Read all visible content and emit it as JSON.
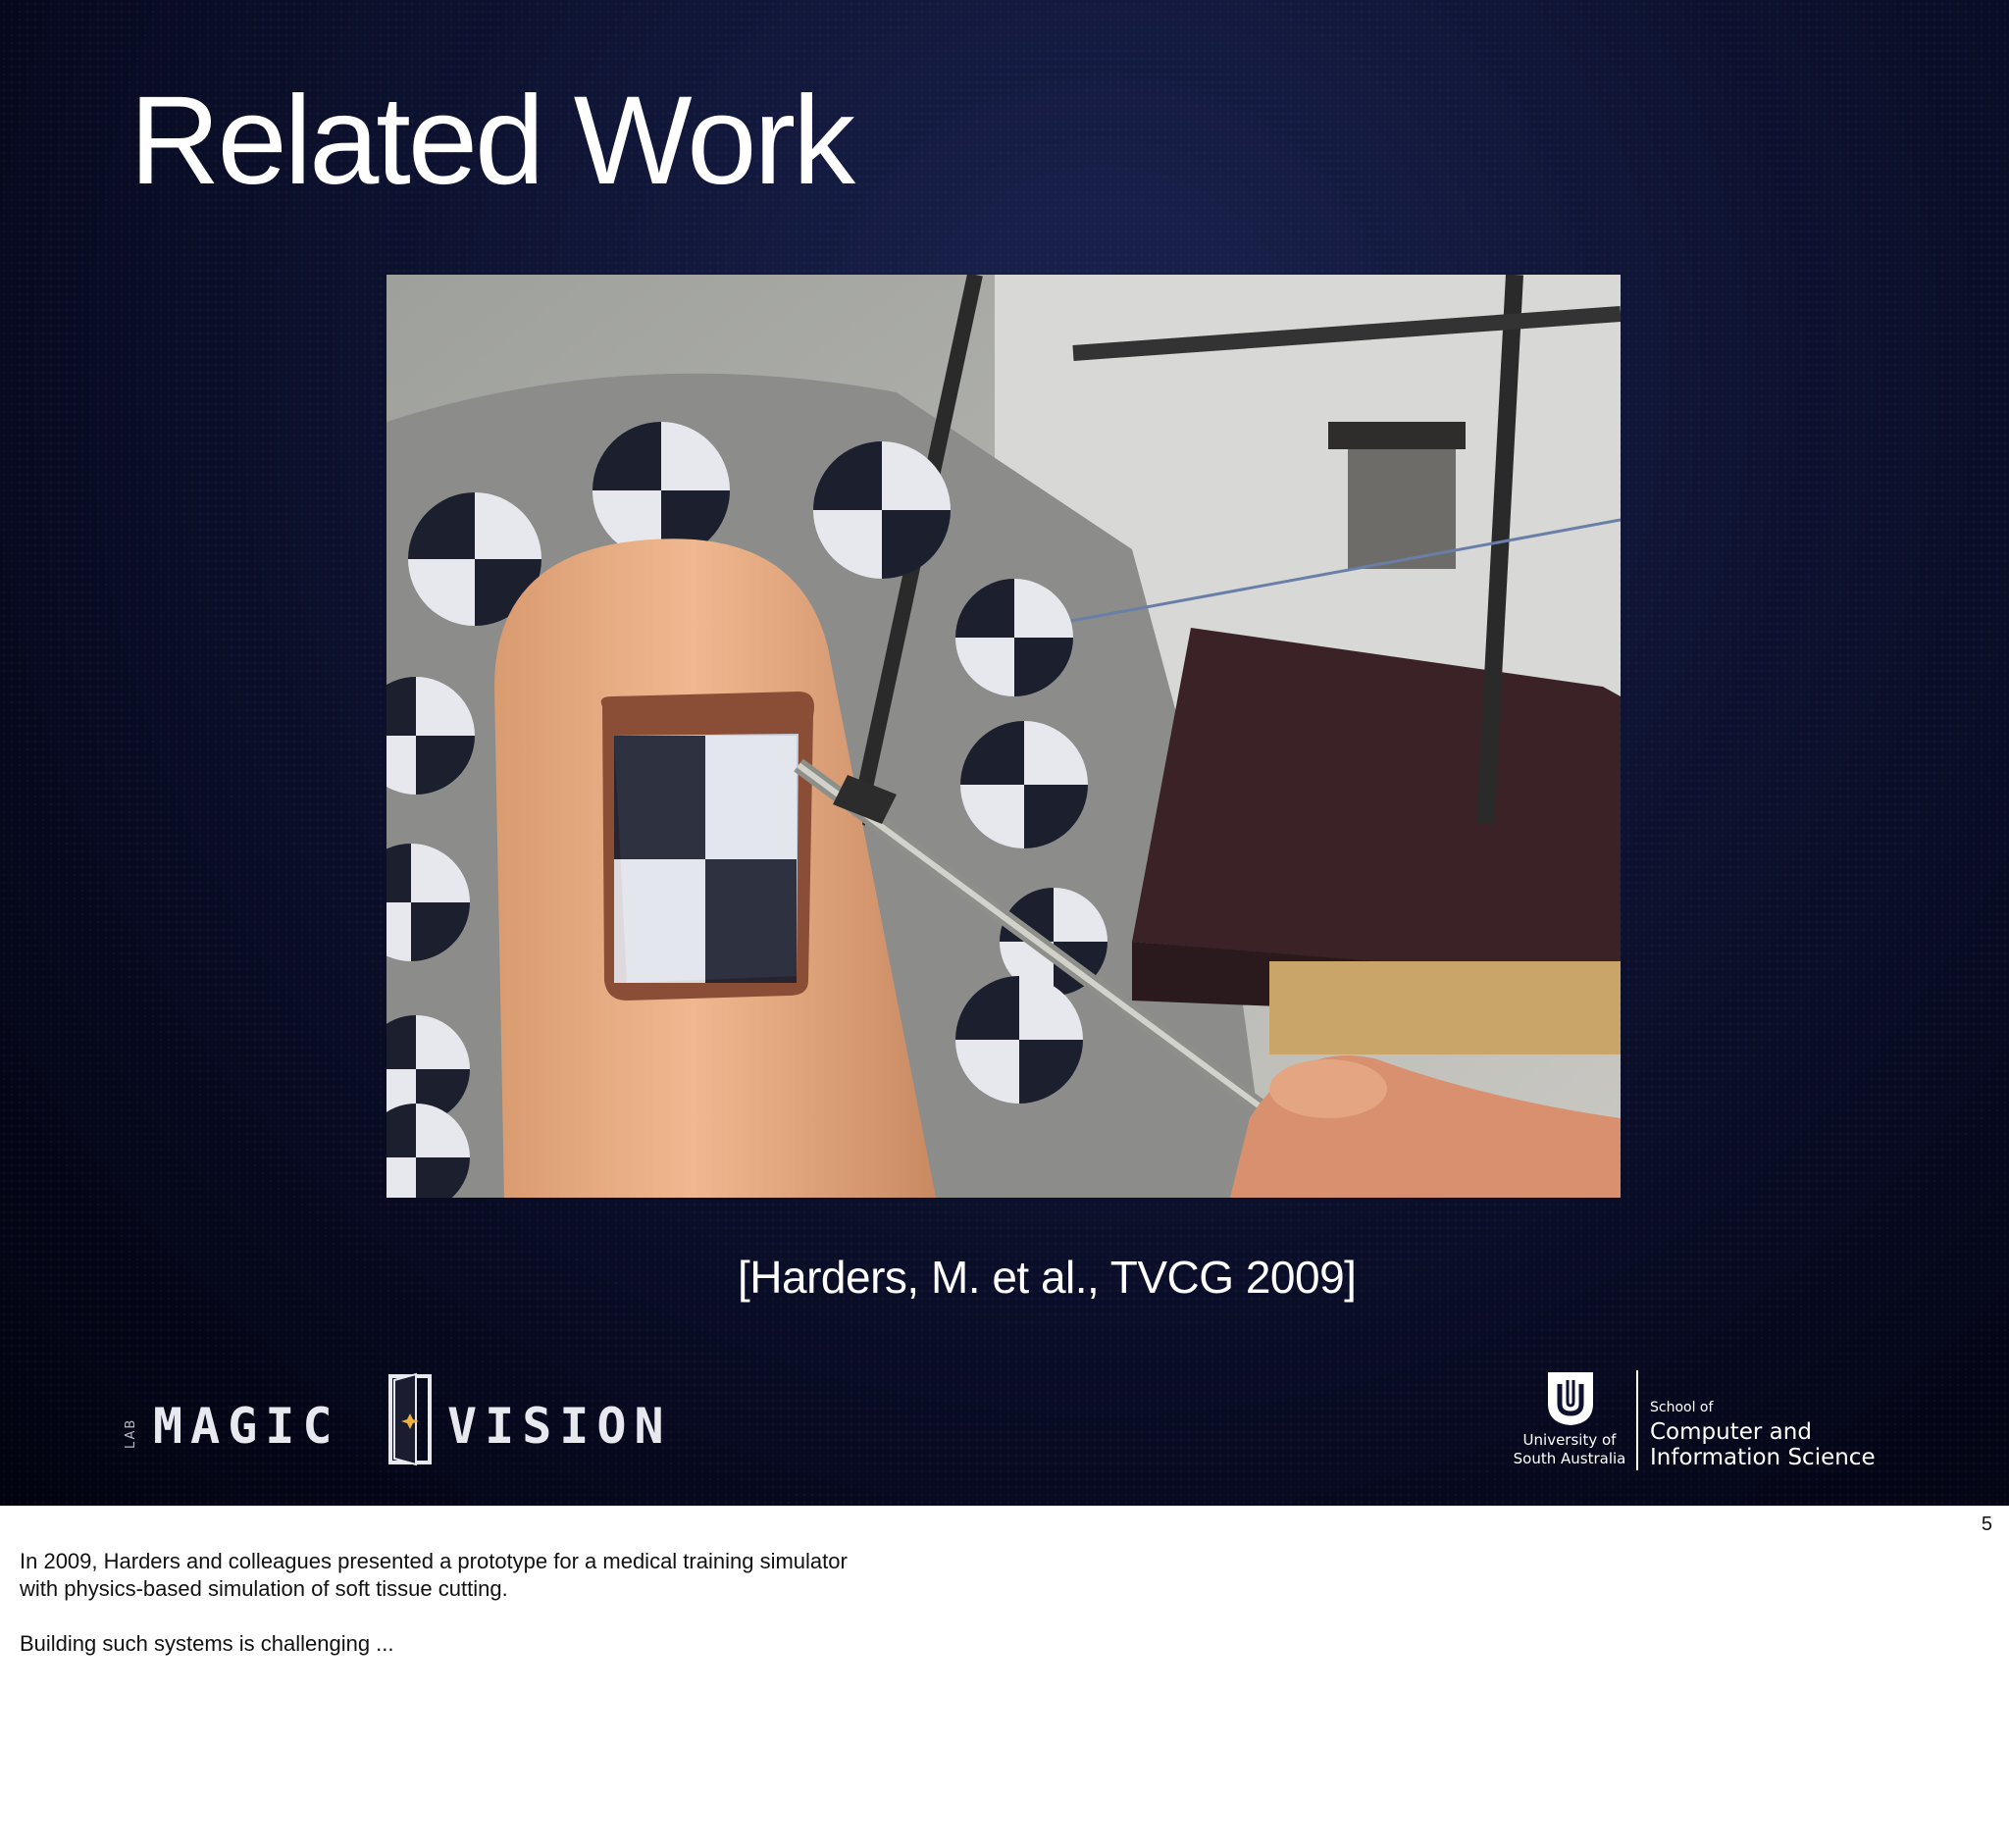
{
  "slide": {
    "title": "Related Work",
    "citation": "[Harders, M. et al., TVCG 2009]",
    "image": {
      "description_icon": "training-simulator-photo"
    }
  },
  "logos": {
    "lab": {
      "vertical_text": "LAB",
      "word_left": "MAGIC",
      "word_right": "VISION"
    },
    "university": {
      "name_line1": "University of",
      "name_line2": "South Australia",
      "school_of": "School of",
      "school_line1": "Computer and",
      "school_line2": "Information Science"
    }
  },
  "page_number": "5",
  "notes": {
    "line1": "In 2009, Harders and colleagues presented a prototype for a medical training simulator",
    "line2": "with physics-based simulation of soft tissue cutting.",
    "line3": "Building such systems is challenging ..."
  },
  "colors": {
    "slide_background": "#0d1230",
    "title_text": "#ffffff",
    "notes_text": "#111111"
  }
}
